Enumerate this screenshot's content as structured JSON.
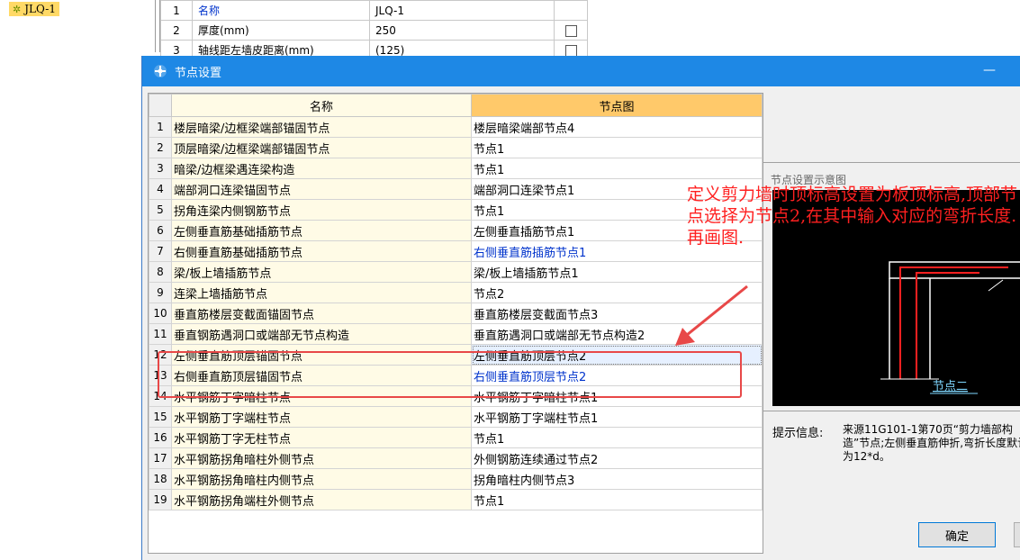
{
  "tree": {
    "item_label": "JLQ-1"
  },
  "properties": [
    {
      "num": "1",
      "name": "名称",
      "value": "JLQ-1",
      "blue": true,
      "checkbox": false
    },
    {
      "num": "2",
      "name": "厚度(mm)",
      "value": "250",
      "blue": false,
      "checkbox": true
    },
    {
      "num": "3",
      "name": "轴线距左墙皮距离(mm)",
      "value": "(125)",
      "blue": false,
      "checkbox": true
    }
  ],
  "dialog": {
    "title": "节点设置",
    "minimize": "—",
    "columns": {
      "name": "名称",
      "node": "节点图"
    },
    "rows": [
      {
        "num": "1",
        "name": "楼层暗梁/边框梁端部锚固节点",
        "node": "楼层暗梁端部节点4",
        "blue": false
      },
      {
        "num": "2",
        "name": "顶层暗梁/边框梁端部锚固节点",
        "node": "节点1",
        "blue": false
      },
      {
        "num": "3",
        "name": "暗梁/边框梁遇连梁构造",
        "node": "节点1",
        "blue": false
      },
      {
        "num": "4",
        "name": "端部洞口连梁锚固节点",
        "node": "端部洞口连梁节点1",
        "blue": false
      },
      {
        "num": "5",
        "name": "拐角连梁内侧钢筋节点",
        "node": "节点1",
        "blue": false
      },
      {
        "num": "6",
        "name": "左侧垂直筋基础插筋节点",
        "node": "左侧垂直插筋节点1",
        "blue": false
      },
      {
        "num": "7",
        "name": "右侧垂直筋基础插筋节点",
        "node": "右侧垂直筋插筋节点1",
        "blue": true
      },
      {
        "num": "8",
        "name": "梁/板上墙插筋节点",
        "node": "梁/板上墙插筋节点1",
        "blue": false
      },
      {
        "num": "9",
        "name": "连梁上墙插筋节点",
        "node": "节点2",
        "blue": false
      },
      {
        "num": "10",
        "name": "垂直筋楼层变截面锚固节点",
        "node": "垂直筋楼层变截面节点3",
        "blue": false
      },
      {
        "num": "11",
        "name": "垂直钢筋遇洞口或端部无节点构造",
        "node": "垂直筋遇洞口或端部无节点构造2",
        "blue": false
      },
      {
        "num": "12",
        "name": "左侧垂直筋顶层锚固节点",
        "node": "左侧垂直筋顶层节点2",
        "blue": false,
        "selected": true
      },
      {
        "num": "13",
        "name": "右侧垂直筋顶层锚固节点",
        "node": "右侧垂直筋顶层节点2",
        "blue": true
      },
      {
        "num": "14",
        "name": "水平钢筋丁字暗柱节点",
        "node": "水平钢筋丁字暗柱节点1",
        "blue": false
      },
      {
        "num": "15",
        "name": "水平钢筋丁字端柱节点",
        "node": "水平钢筋丁字端柱节点1",
        "blue": false
      },
      {
        "num": "16",
        "name": "水平钢筋丁字无柱节点",
        "node": "节点1",
        "blue": false
      },
      {
        "num": "17",
        "name": "水平钢筋拐角暗柱外侧节点",
        "node": "外侧钢筋连续通过节点2",
        "blue": false
      },
      {
        "num": "18",
        "name": "水平钢筋拐角暗柱内侧节点",
        "node": "拐角暗柱内侧节点3",
        "blue": false
      },
      {
        "num": "19",
        "name": "水平钢筋拐角端柱外侧节点",
        "node": "节点1",
        "blue": false
      }
    ],
    "preview": {
      "label": "节点设置示意图",
      "diagram_label": "节点二"
    },
    "hint": {
      "label": "提示信息:",
      "text": "来源11G101-1第70页“剪力墙部构造”节点;左侧垂直筋伸折,弯折长度默认为12*d。"
    },
    "ok_button": "确定"
  },
  "annotation": {
    "text": "定义剪力墙时顶标高设置为板顶标高,顶部节点选择为节点2,在其中输入对应的弯折长度.再画图.",
    "color": "#ff2020"
  }
}
